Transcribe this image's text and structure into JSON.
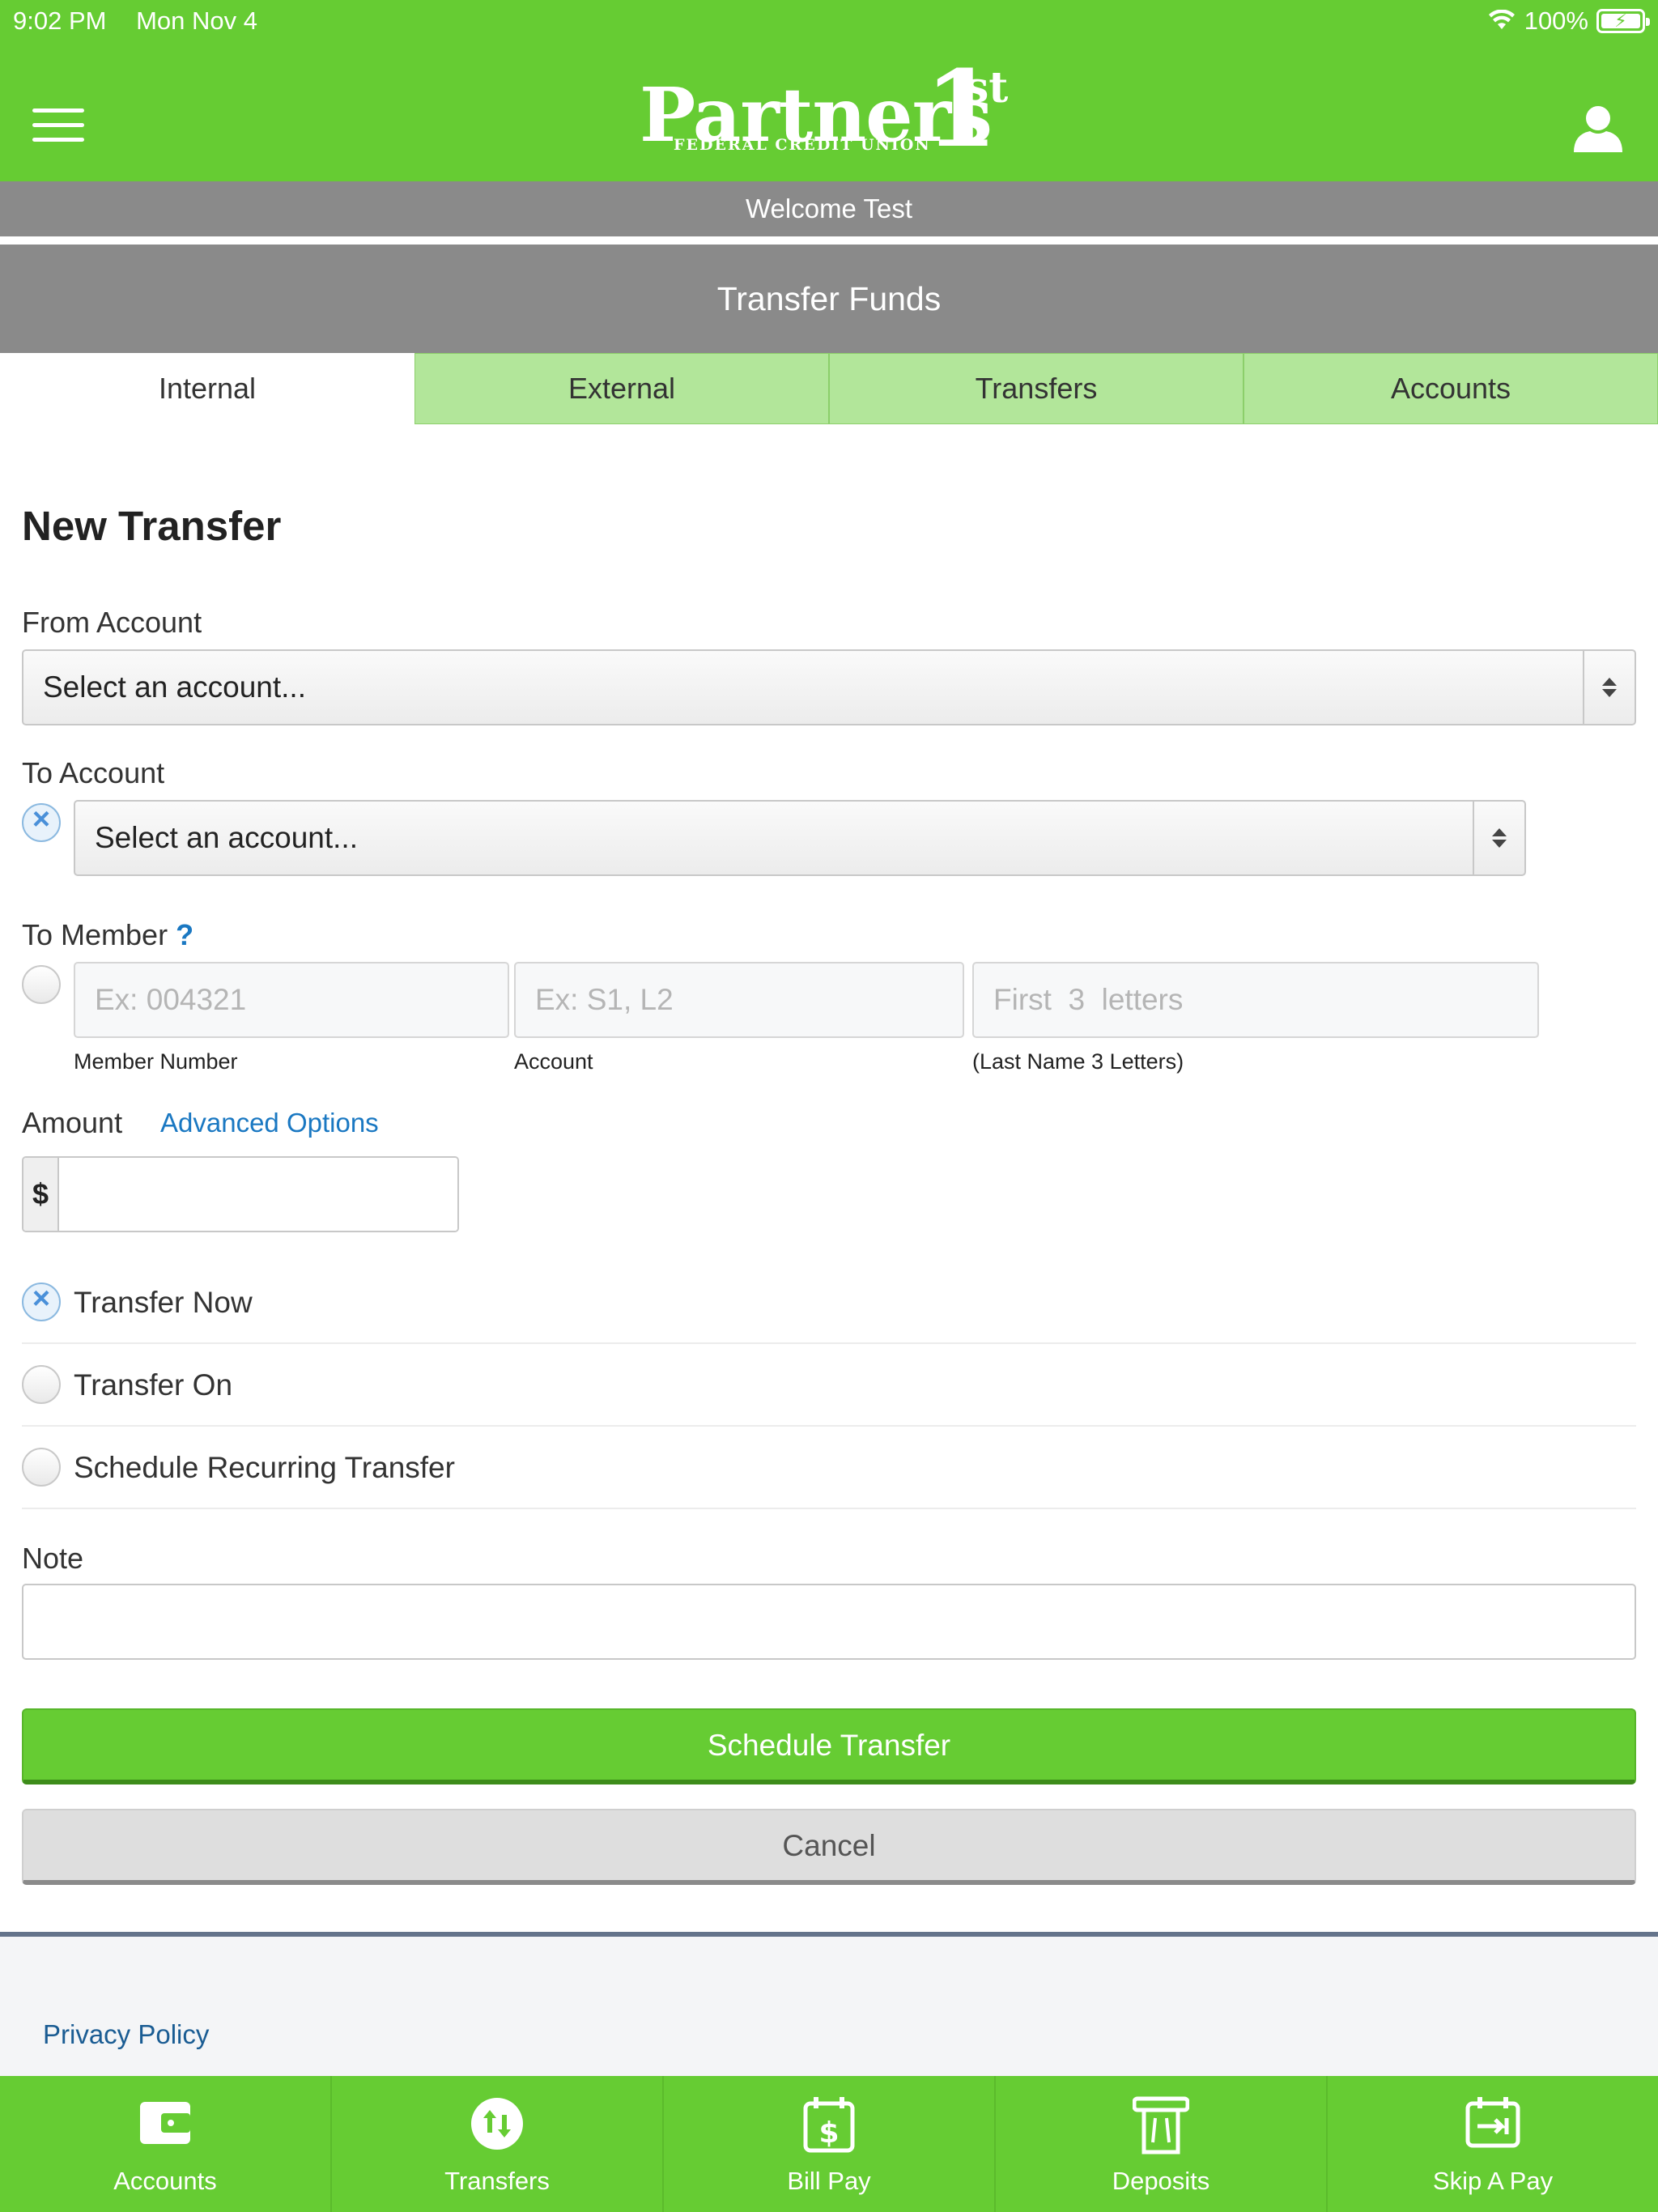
{
  "status_bar": {
    "time": "9:02 PM",
    "date": "Mon Nov 4",
    "battery": "100%"
  },
  "header": {
    "logo_word": "Partners",
    "logo_one": "1",
    "logo_st": "st",
    "logo_sub": "FEDERAL CREDIT UNION",
    "welcome": "Welcome Test",
    "page_title": "Transfer Funds"
  },
  "tabs": [
    {
      "label": "Internal",
      "active": true
    },
    {
      "label": "External",
      "active": false
    },
    {
      "label": "Transfers",
      "active": false
    },
    {
      "label": "Accounts",
      "active": false
    }
  ],
  "form": {
    "heading": "New Transfer",
    "from_account_label": "From Account",
    "from_account_value": "Select an account...",
    "to_account_label": "To Account",
    "to_account_value": "Select an account...",
    "to_member_label": "To Member",
    "to_member_help": "?",
    "member_number_placeholder": "Ex: 004321",
    "member_number_label": "Member Number",
    "account_placeholder": "Ex: S1, L2",
    "account_label": "Account",
    "last_name_placeholder": "First  3  letters",
    "last_name_label": "(Last Name  3  Letters)",
    "amount_label": "Amount",
    "advanced_options": "Advanced Options",
    "currency_symbol": "$",
    "amount_value": "",
    "options": [
      {
        "label": "Transfer Now",
        "checked": true
      },
      {
        "label": "Transfer On",
        "checked": false
      },
      {
        "label": "Schedule Recurring Transfer",
        "checked": false
      }
    ],
    "note_label": "Note",
    "note_value": "",
    "submit_label": "Schedule Transfer",
    "cancel_label": "Cancel"
  },
  "footer": {
    "privacy_policy": "Privacy Policy"
  },
  "bottom_nav": [
    {
      "label": "Accounts",
      "icon": "wallet-icon"
    },
    {
      "label": "Transfers",
      "icon": "transfer-arrows-icon"
    },
    {
      "label": "Bill Pay",
      "icon": "bill-calendar-icon"
    },
    {
      "label": "Deposits",
      "icon": "check-deposit-icon"
    },
    {
      "label": "Skip A Pay",
      "icon": "skip-calendar-icon"
    }
  ],
  "colors": {
    "brand_green": "#66cc33",
    "tab_inactive": "#b2e69a",
    "title_bar_gray": "#8a8a8a",
    "link_blue": "#1a78c2"
  }
}
